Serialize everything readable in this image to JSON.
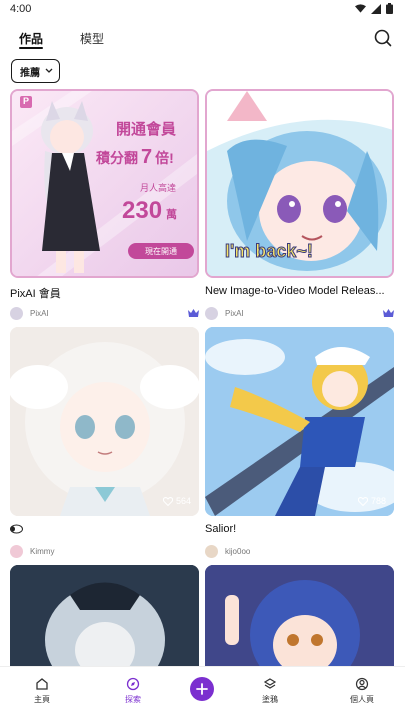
{
  "status": {
    "time": "4:00"
  },
  "tabs": [
    {
      "label": "作品"
    },
    {
      "label": "模型"
    }
  ],
  "sort": {
    "selected": "推薦"
  },
  "cards": [
    {
      "title": "PixAI 會員",
      "author": "PixAI",
      "promo": {
        "badge": "P",
        "headline": "開通會員",
        "line2": "積分翻",
        "multiplier": "7",
        "suffix": "倍!",
        "sub": "月人高達",
        "number": "230",
        "unit": "萬",
        "cta": "現在開通"
      }
    },
    {
      "title": "New Image-to-Video Model Releas...",
      "author": "PixAI",
      "overlay_text": "I'm back~!"
    },
    {
      "title": "​",
      "title_icon": "sheep-emoji-icon",
      "author": "Kimmy",
      "likes": "564"
    },
    {
      "title": "Salior!",
      "author": "kijo0oo",
      "likes": "788"
    }
  ],
  "nav": [
    {
      "label": "主頁"
    },
    {
      "label": "探索"
    },
    {
      "label": "塗鴉"
    },
    {
      "label": "個人頁"
    }
  ],
  "colors": {
    "accent": "#7b2fcf",
    "promo_pink": "#e9b6d8",
    "crown_blue": "#5b5bd6"
  }
}
